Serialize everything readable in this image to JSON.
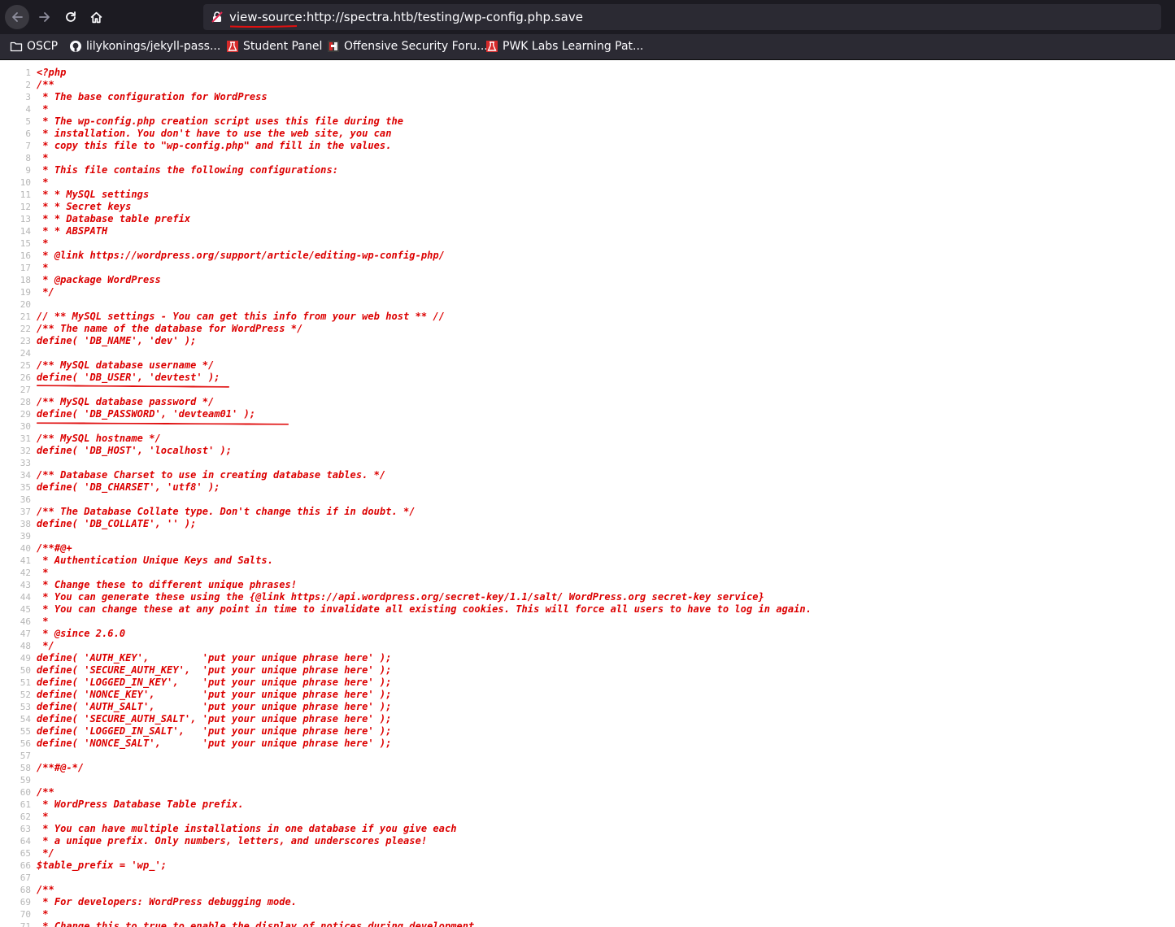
{
  "browser": {
    "url_prefix": "view-source:",
    "url": "http://spectra.htb/testing/wp-config.php.save"
  },
  "bookmarks": [
    {
      "label": "OSCP",
      "icon": "folder-icon"
    },
    {
      "label": "lilykonings/jekyll-pass...",
      "icon": "github-icon"
    },
    {
      "label": "Student Panel",
      "icon": "offsec-icon"
    },
    {
      "label": "Offensive Security Foru...",
      "icon": "forum-icon"
    },
    {
      "label": "PWK Labs Learning Pat...",
      "icon": "offsec-icon"
    }
  ],
  "colors": {
    "code": "#dc0000",
    "line_numbers": "#b6b6b6",
    "annotation": "#e01010"
  },
  "source_lines": [
    "<?php",
    "/**",
    " * The base configuration for WordPress",
    " *",
    " * The wp-config.php creation script uses this file during the",
    " * installation. You don't have to use the web site, you can",
    " * copy this file to \"wp-config.php\" and fill in the values.",
    " *",
    " * This file contains the following configurations:",
    " *",
    " * * MySQL settings",
    " * * Secret keys",
    " * * Database table prefix",
    " * * ABSPATH",
    " *",
    " * @link https://wordpress.org/support/article/editing-wp-config-php/",
    " *",
    " * @package WordPress",
    " */",
    "",
    "// ** MySQL settings - You can get this info from your web host ** //",
    "/** The name of the database for WordPress */",
    "define( 'DB_NAME', 'dev' );",
    "",
    "/** MySQL database username */",
    "define( 'DB_USER', 'devtest' );",
    "",
    "/** MySQL database password */",
    "define( 'DB_PASSWORD', 'devteam01' );",
    "",
    "/** MySQL hostname */",
    "define( 'DB_HOST', 'localhost' );",
    "",
    "/** Database Charset to use in creating database tables. */",
    "define( 'DB_CHARSET', 'utf8' );",
    "",
    "/** The Database Collate type. Don't change this if in doubt. */",
    "define( 'DB_COLLATE', '' );",
    "",
    "/**#@+",
    " * Authentication Unique Keys and Salts.",
    " *",
    " * Change these to different unique phrases!",
    " * You can generate these using the {@link https://api.wordpress.org/secret-key/1.1/salt/ WordPress.org secret-key service}",
    " * You can change these at any point in time to invalidate all existing cookies. This will force all users to have to log in again.",
    " *",
    " * @since 2.6.0",
    " */",
    "define( 'AUTH_KEY',         'put your unique phrase here' );",
    "define( 'SECURE_AUTH_KEY',  'put your unique phrase here' );",
    "define( 'LOGGED_IN_KEY',    'put your unique phrase here' );",
    "define( 'NONCE_KEY',        'put your unique phrase here' );",
    "define( 'AUTH_SALT',        'put your unique phrase here' );",
    "define( 'SECURE_AUTH_SALT', 'put your unique phrase here' );",
    "define( 'LOGGED_IN_SALT',   'put your unique phrase here' );",
    "define( 'NONCE_SALT',       'put your unique phrase here' );",
    "",
    "/**#@-*/",
    "",
    "/**",
    " * WordPress Database Table prefix.",
    " *",
    " * You can have multiple installations in one database if you give each",
    " * a unique prefix. Only numbers, letters, and underscores please!",
    " */",
    "$table_prefix = 'wp_';",
    "",
    "/**",
    " * For developers: WordPress debugging mode.",
    " *",
    " * Change this to true to enable the display of notices during development."
  ]
}
